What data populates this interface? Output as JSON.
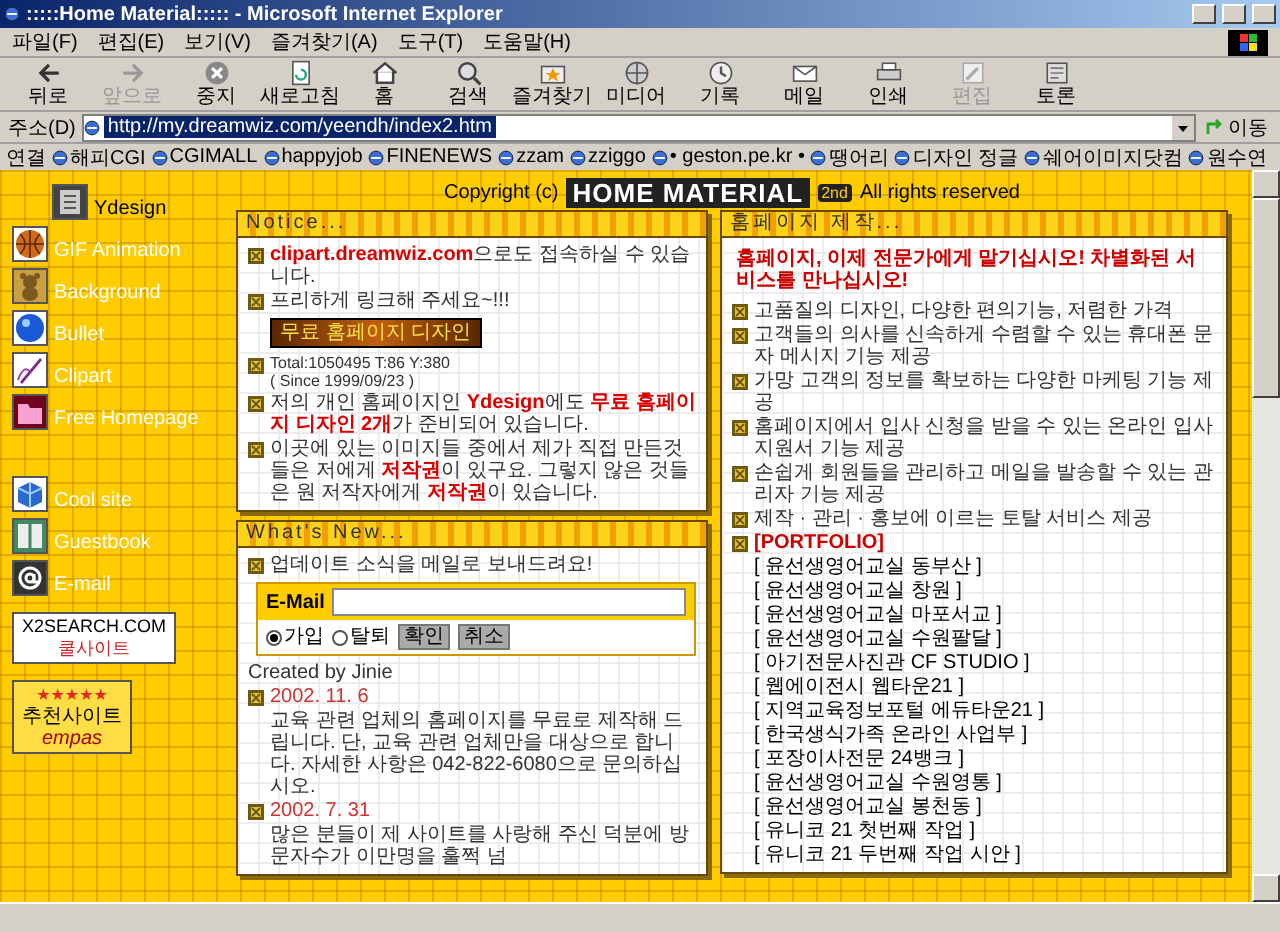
{
  "window": {
    "title": ":::::Home Material::::: - Microsoft Internet Explorer"
  },
  "menu_bar": [
    "파일(F)",
    "편집(E)",
    "보기(V)",
    "즐겨찾기(A)",
    "도구(T)",
    "도움말(H)"
  ],
  "toolbar": [
    {
      "label": "뒤로",
      "disabled": false
    },
    {
      "label": "앞으로",
      "disabled": true
    },
    {
      "label": "중지",
      "disabled": false
    },
    {
      "label": "새로고침",
      "disabled": false
    },
    {
      "label": "홈",
      "disabled": false
    },
    {
      "label": "검색",
      "disabled": false
    },
    {
      "label": "즐겨찾기",
      "disabled": false
    },
    {
      "label": "미디어",
      "disabled": false
    },
    {
      "label": "기록",
      "disabled": false
    },
    {
      "label": "메일",
      "disabled": false
    },
    {
      "label": "인쇄",
      "disabled": false
    },
    {
      "label": "편집",
      "disabled": true
    },
    {
      "label": "토론",
      "disabled": false
    }
  ],
  "address_bar": {
    "label": "주소(D)",
    "url": "http://my.dreamwiz.com/yeendh/index2.htm",
    "go": "이동"
  },
  "links_bar": {
    "label": "연결",
    "items": [
      "해피CGI",
      "CGIMALL",
      "happyjob",
      "FINENEWS",
      "zzam",
      "zziggo",
      "• geston.pe.kr •",
      "땡어리",
      "디자인 정글",
      "쉐어이미지닷컴",
      "원수연"
    ]
  },
  "sidebar": {
    "top_item": "Ydesign",
    "groups": [
      [
        "GIF Animation",
        "Background",
        "Bullet",
        "Clipart",
        "Free Homepage"
      ],
      [
        "Cool site",
        "Guestbook",
        "E-mail"
      ]
    ],
    "badges": [
      {
        "lines": [
          "X2SEARCH.COM",
          "쿨사이트"
        ]
      },
      {
        "lines": [
          "★★★★★",
          "추천사이트",
          "empas"
        ]
      }
    ]
  },
  "header": {
    "prefix": "Copyright (c)",
    "logo": "HOME MATERIAL",
    "edition": "2nd",
    "suffix": "All rights reserved"
  },
  "notice": {
    "title": "Notice...",
    "items": [
      {
        "kind": "text",
        "text": "**clipart.dreamwiz.com**으로도 접속하실 수 있습니다."
      },
      {
        "kind": "text",
        "text": "프리하게 링크해 주세요~!!!"
      },
      {
        "kind": "banner",
        "text": "무료 홈페이지 디자인"
      },
      {
        "kind": "counter",
        "lines": [
          "Total:1050495 T:86 Y:380",
          "( Since 1999/09/23 )"
        ]
      },
      {
        "kind": "text",
        "text": "저의 개인 홈페이지인 **Ydesign**에도 **무료 홈페이지 디자인 2개**가 준비되어 있습니다."
      },
      {
        "kind": "text",
        "text": "이곳에 있는 이미지들 중에서 제가 직접 만든것들은 저에게 **저작권**이 있구요. 그렇지 않은 것들은 원 저작자에게 **저작권**이 있습니다."
      }
    ]
  },
  "whats_new": {
    "title": "What's New...",
    "intro": "업데이트 소식을 메일로 보내드려요!",
    "form": {
      "label": "E-Mail",
      "options": [
        {
          "label": "가입",
          "selected": true
        },
        {
          "label": "탈퇴",
          "selected": false
        }
      ],
      "buttons": [
        "확인",
        "취소"
      ]
    },
    "credit": "Created by Jinie",
    "entries": [
      {
        "date": "2002. 11. 6",
        "text": "교육 관련 업체의 홈페이지를 무료로 제작해 드립니다. 단, 교육 관련 업체만을 대상으로 합니다. 자세한 사항은 042-822-6080으로 문의하십시오."
      },
      {
        "date": "2002. 7. 31",
        "text": "많은 분들이 제 사이트를 사랑해 주신 덕분에 방문자수가 이만명을 훌쩍 넘"
      }
    ]
  },
  "homepage_panel": {
    "title": "홈페이지 제작...",
    "headline": "홈페이지, 이제 전문가에게 맡기십시오! 차별화된 서비스를 만나십시오!",
    "features": [
      "고품질의 디자인, 다양한 편의기능, 저렴한 가격",
      "고객들의 의사를 신속하게 수렴할 수 있는 휴대폰 문자 메시지 기능 제공",
      "가망 고객의 정보를 확보하는 다양한 마케팅 기능 제공",
      "홈페이지에서 입사 신청을 받을 수 있는 온라인 입사 지원서 기능 제공",
      "손쉽게 회원들을 관리하고 메일을 발송할 수 있는 관리자 기능 제공",
      "제작 · 관리 · 홍보에 이르는 토탈 서비스 제공"
    ],
    "portfolio": {
      "title": "[PORTFOLIO]",
      "items": [
        "[ 윤선생영어교실 동부산 ]",
        "[ 윤선생영어교실 창원 ]",
        "[ 윤선생영어교실 마포서교 ]",
        "[ 윤선생영어교실 수원팔달 ]",
        "[ 아기전문사진관 CF STUDIO ]",
        "[ 웹에이전시 웹타운21 ]",
        "[ 지역교육정보포털 에듀타운21 ]",
        "[ 한국생식가족 온라인 사업부 ]",
        "[ 포장이사전문 24뱅크 ]",
        "[ 윤선생영어교실 수원영통 ]",
        "[ 윤선생영어교실 봉천동 ]",
        "[ 유니코 21 첫번째 작업 ]",
        "[ 유니코 21 두번째 작업 시안 ]"
      ]
    }
  }
}
